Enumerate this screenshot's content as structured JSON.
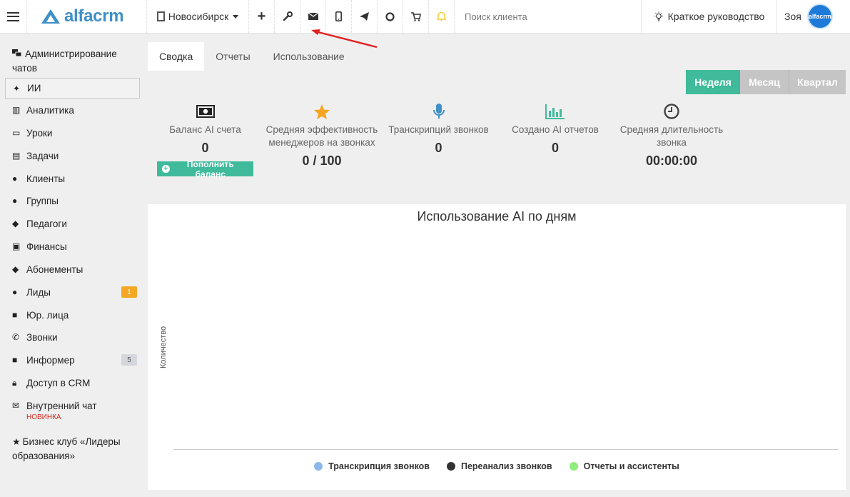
{
  "header": {
    "logo_text": "alfacrm",
    "city": "Новосибирск",
    "search_placeholder": "Поиск клиента",
    "guide_label": "Краткое руководство",
    "user_name": "Зоя",
    "avatar_text": "alfacrm",
    "icons": [
      "plus-icon",
      "wrench-icon",
      "envelope-icon",
      "mobile-icon",
      "telegram-icon",
      "chat-icon",
      "cart-icon",
      "bell-icon"
    ]
  },
  "sidebar": {
    "items": [
      {
        "label": "Администрирование чатов",
        "icon": "chats-icon"
      },
      {
        "label": "ИИ",
        "icon": "sparkle-icon",
        "active": true
      },
      {
        "label": "Аналитика",
        "icon": "map-icon"
      },
      {
        "label": "Уроки",
        "icon": "calendar-icon"
      },
      {
        "label": "Задачи",
        "icon": "clipboard-icon"
      },
      {
        "label": "Клиенты",
        "icon": "user-icon"
      },
      {
        "label": "Группы",
        "icon": "users-icon"
      },
      {
        "label": "Педагоги",
        "icon": "graduation-cap-icon"
      },
      {
        "label": "Финансы",
        "icon": "money-icon"
      },
      {
        "label": "Абонементы",
        "icon": "tag-icon"
      },
      {
        "label": "Лиды",
        "icon": "user-plus-icon",
        "badge": "1"
      },
      {
        "label": "Юр. лица",
        "icon": "briefcase-icon"
      },
      {
        "label": "Звонки",
        "icon": "phone-icon"
      },
      {
        "label": "Информер",
        "icon": "book-icon",
        "badge": "5"
      },
      {
        "label": "Доступ в CRM",
        "icon": "lock-icon"
      },
      {
        "label": "Внутренний чат",
        "icon": "envelope-icon",
        "tag": "НОВИНКА"
      },
      {
        "label": "Бизнес клуб «Лидеры образования»",
        "icon": "star-icon"
      }
    ]
  },
  "tabs": [
    "Сводка",
    "Отчеты",
    "Использование"
  ],
  "period": [
    "Неделя",
    "Месяц",
    "Квартал"
  ],
  "stats": [
    {
      "label": "Баланс AI счета",
      "value": "0",
      "button": "Пополнить баланс",
      "icon": "money-icon"
    },
    {
      "label": "Средняя эффективность менеджеров на звонках",
      "value": "0 / 100",
      "icon": "star-icon"
    },
    {
      "label": "Транскрипций звонков",
      "value": "0",
      "icon": "microphone-icon"
    },
    {
      "label": "Создано AI отчетов",
      "value": "0",
      "icon": "bar-chart-icon"
    },
    {
      "label": "Средняя длительность звонка",
      "value": "00:00:00",
      "icon": "clock-icon"
    }
  ],
  "colors": {
    "accent": "#3fbb9c",
    "brand": "#3f90c8",
    "annotation": "#e02020"
  },
  "chart_data": {
    "type": "bar",
    "title": "Использование AI по дням",
    "xlabel": "",
    "ylabel": "Количество",
    "categories": [],
    "series": [
      {
        "name": "Транскрипция звонков",
        "color": "#8ab8e8",
        "values": []
      },
      {
        "name": "Переанализ звонков",
        "color": "#333333",
        "values": []
      },
      {
        "name": "Отчеты и ассистенты",
        "color": "#90ed7d",
        "values": []
      }
    ],
    "legend": "bottom"
  }
}
